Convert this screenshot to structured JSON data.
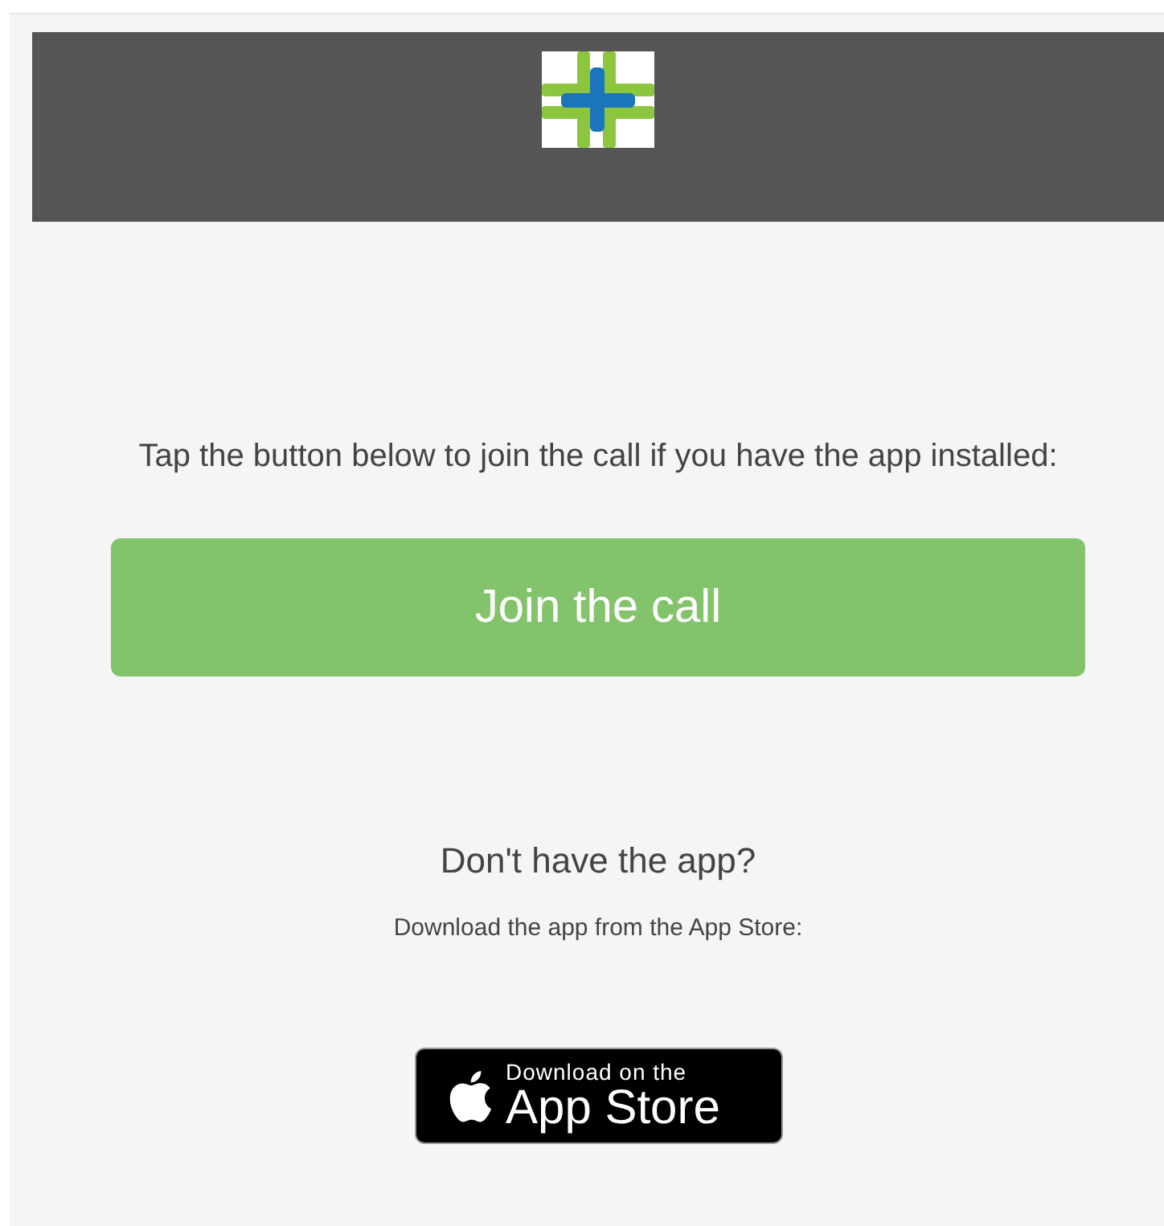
{
  "intro_text": "Tap the button below to join the call if you have the app installed:",
  "join_button": {
    "label": "Join the call"
  },
  "no_app_heading": "Don't have the app?",
  "download_text": "Download the app from the App Store:",
  "store_badge": {
    "small_text": "Download on the",
    "large_text": "App Store"
  }
}
